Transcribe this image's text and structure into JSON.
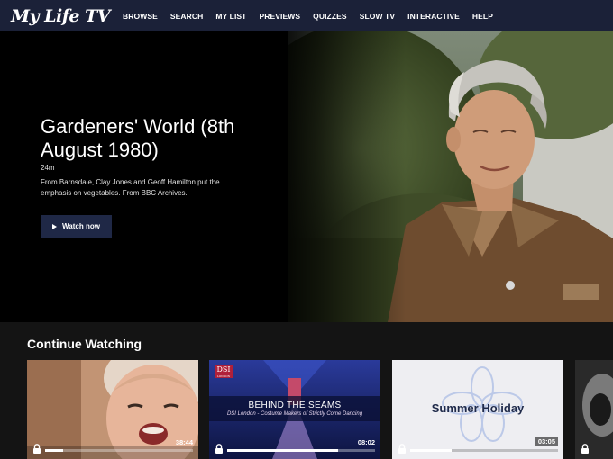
{
  "nav": {
    "logo": "My Life TV",
    "items": [
      "BROWSE",
      "SEARCH",
      "MY LIST",
      "PREVIEWS",
      "QUIZZES",
      "SLOW TV",
      "INTERACTIVE",
      "HELP"
    ]
  },
  "hero": {
    "title": "Gardeners' World (8th August 1980)",
    "duration": "24m",
    "description": "From Barnsdale, Clay Jones and Geoff Hamilton put the emphasis on vegetables. From BBC Archives.",
    "watch_label": "Watch now"
  },
  "continue": {
    "title": "Continue Watching",
    "cards": [
      {
        "time": "38:44",
        "progress": 0.12
      },
      {
        "time": "08:02",
        "progress": 0.75,
        "badge": "DSI",
        "badge_sub": "LONDON",
        "headline": "BEHIND THE SEAMS",
        "subline": "DSI London - Costume Makers of Strictly Come Dancing"
      },
      {
        "time": "03:05",
        "progress": 0.28,
        "headline": "Summer Holiday"
      },
      {
        "time": "",
        "progress": 0
      }
    ]
  },
  "colors": {
    "nav_bg": "#1b2138",
    "button_bg": "#1f2846",
    "page_bg": "#141414"
  }
}
